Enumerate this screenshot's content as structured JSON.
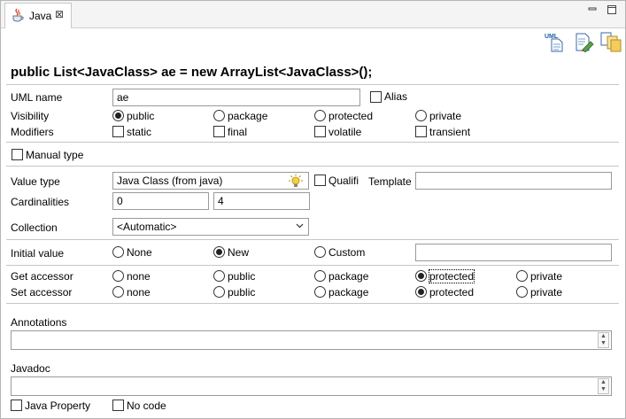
{
  "tab": {
    "label": "Java",
    "close": "⊠"
  },
  "heading": "public List<JavaClass> ae = new ArrayList<JavaClass>();",
  "uml_name": {
    "label": "UML name",
    "value": "ae"
  },
  "alias": {
    "label": "Alias",
    "checked": false
  },
  "visibility": {
    "label": "Visibility",
    "options": [
      "public",
      "package",
      "protected",
      "private"
    ],
    "selected": "public"
  },
  "modifiers": {
    "label": "Modifiers",
    "options": [
      "static",
      "final",
      "volatile",
      "transient"
    ]
  },
  "manual_type": {
    "label": "Manual type",
    "checked": false
  },
  "value_type": {
    "label": "Value type",
    "value": "Java Class  (from java)",
    "icon": "lightbulb-icon"
  },
  "qualified": {
    "label": "Qualifi"
  },
  "template": {
    "label": "Template",
    "value": ""
  },
  "cardinalities": {
    "label": "Cardinalities",
    "min": "0",
    "max": "4"
  },
  "collection": {
    "label": "Collection",
    "selected": "<Automatic>"
  },
  "initial_value": {
    "label": "Initial value",
    "options": [
      "None",
      "New",
      "Custom"
    ],
    "selected": "New",
    "custom_value": ""
  },
  "get_accessor": {
    "label": "Get accessor",
    "options": [
      "none",
      "public",
      "package",
      "protected",
      "private"
    ],
    "selected": "protected"
  },
  "set_accessor": {
    "label": "Set accessor",
    "options": [
      "none",
      "public",
      "package",
      "protected",
      "private"
    ],
    "selected": "protected"
  },
  "annotations": {
    "label": "Annotations",
    "value": ""
  },
  "javadoc": {
    "label": "Javadoc",
    "value": ""
  },
  "java_property": {
    "label": "Java Property",
    "checked": false
  },
  "no_code": {
    "label": "No code",
    "checked": false
  },
  "toolbar": {
    "icons": [
      "uml-document-icon",
      "edit-document-icon",
      "copy-documents-icon"
    ]
  }
}
